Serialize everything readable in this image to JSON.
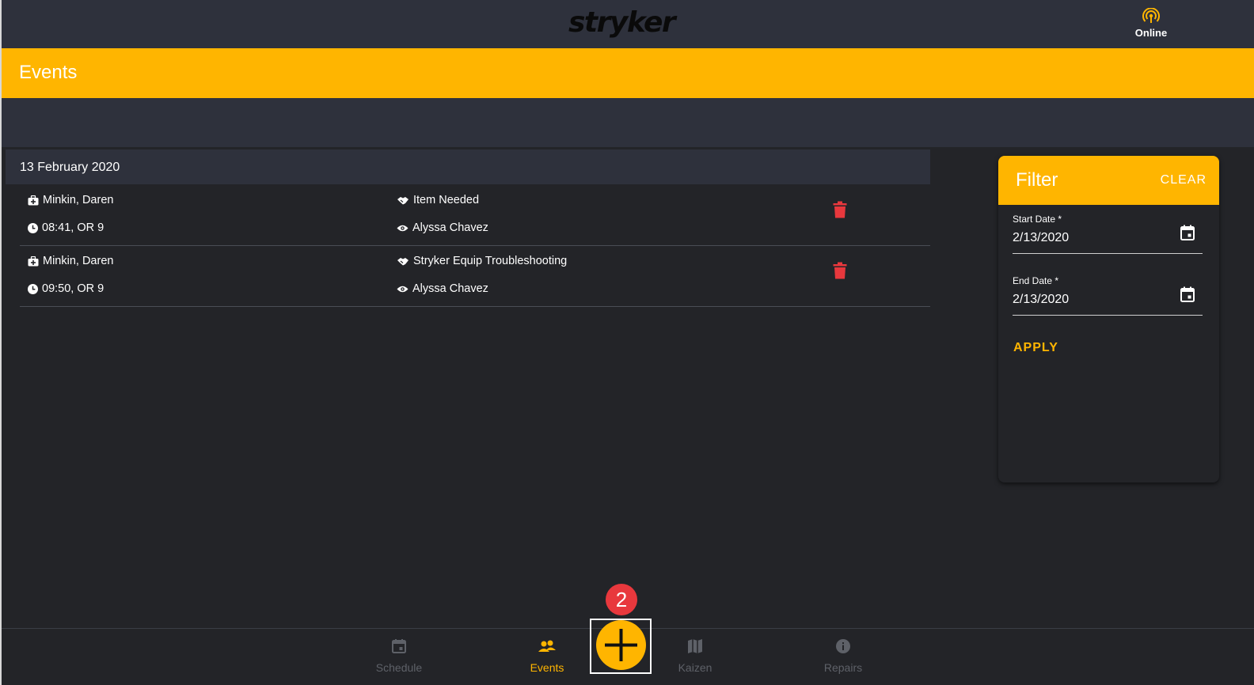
{
  "brand": {
    "logo_text": "stryker"
  },
  "connection": {
    "status_label": "Online",
    "icon": "signal-icon"
  },
  "page": {
    "title": "Events"
  },
  "events": {
    "date_header": "13 February 2020",
    "rows": [
      {
        "patient": "Minkin, Daren",
        "time_room": "08:41, OR 9",
        "event_type": "Item Needed",
        "assigned": "Alyssa Chavez"
      },
      {
        "patient": "Minkin, Daren",
        "time_room": "09:50, OR 9",
        "event_type": "Stryker Equip Troubleshooting",
        "assigned": "Alyssa Chavez"
      }
    ]
  },
  "filter": {
    "title": "Filter",
    "clear_label": "CLEAR",
    "start_label": "Start Date *",
    "start_value": "2/13/2020",
    "end_label": "End Date *",
    "end_value": "2/13/2020",
    "apply_label": "APPLY"
  },
  "nav": {
    "items": [
      {
        "label": "Schedule",
        "icon": "calendar-icon"
      },
      {
        "label": "Events",
        "icon": "people-icon"
      },
      {
        "label": "Kaizen",
        "icon": "map-icon"
      },
      {
        "label": "Repairs",
        "icon": "info-icon"
      }
    ],
    "active": "Events",
    "fab_badge": "2"
  },
  "colors": {
    "accent": "#ffb500",
    "topbar": "#2e313c",
    "background": "#232428",
    "danger": "#e8383d"
  }
}
